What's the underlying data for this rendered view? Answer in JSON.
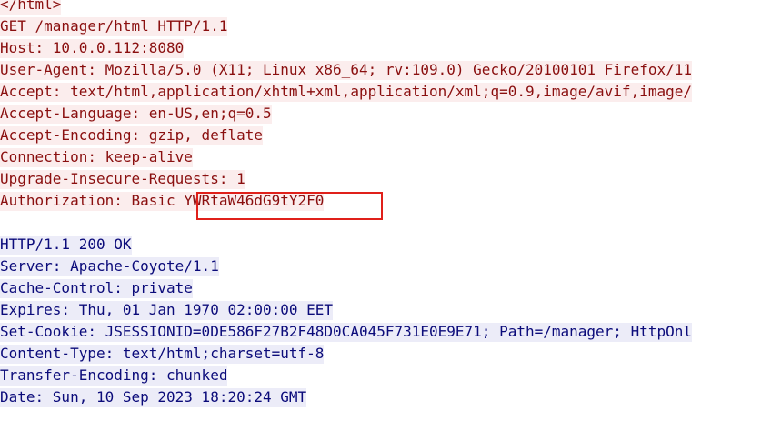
{
  "request": {
    "lines": [
      "</html>",
      "GET /manager/html HTTP/1.1",
      "Host: 10.0.0.112:8080",
      "User-Agent: Mozilla/5.0 (X11; Linux x86_64; rv:109.0) Gecko/20100101 Firefox/11",
      "Accept: text/html,application/xhtml+xml,application/xml;q=0.9,image/avif,image/",
      "Accept-Language: en-US,en;q=0.5",
      "Accept-Encoding: gzip, deflate",
      "Connection: keep-alive",
      "Upgrade-Insecure-Requests: 1"
    ],
    "auth_prefix": "Authorization: Basic ",
    "auth_token": "YWRtaW46dG9tY2F0"
  },
  "response": {
    "lines": [
      "HTTP/1.1 200 OK",
      "Server: Apache-Coyote/1.1",
      "Cache-Control: private",
      "Expires: Thu, 01 Jan 1970 02:00:00 EET",
      "Set-Cookie: JSESSIONID=0DE586F27B2F48D0CA045F731E0E9E71; Path=/manager; HttpOnl",
      "Content-Type: text/html;charset=utf-8",
      "Transfer-Encoding: chunked",
      "Date: Sun, 10 Sep 2023 18:20:24 GMT"
    ]
  },
  "colors": {
    "request_text": "#8a0f0f",
    "request_bg": "#fbeded",
    "response_text": "#0b0b7a",
    "response_bg": "#ececf8",
    "highlight_border": "#e0201a"
  }
}
